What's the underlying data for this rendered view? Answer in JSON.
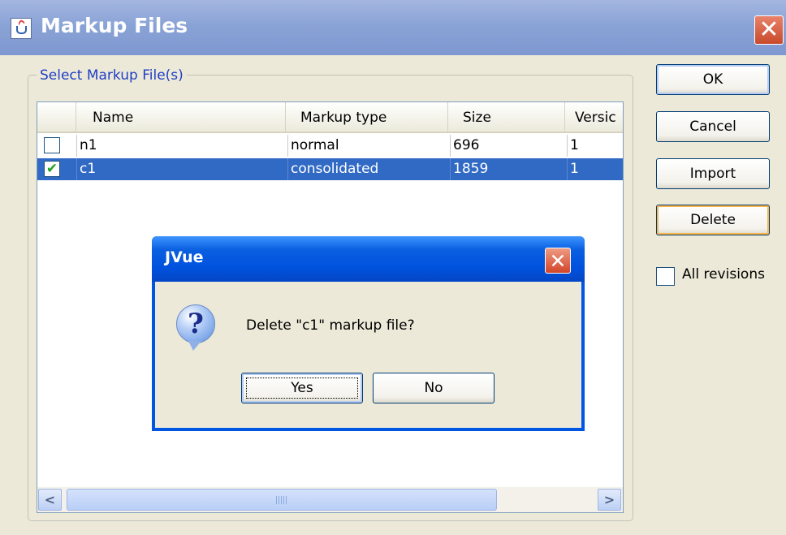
{
  "window": {
    "title": "Markup Files",
    "close_glyph": "✕",
    "app_icon": "java-cup-icon"
  },
  "group": {
    "legend": "Select Markup File(s)"
  },
  "table": {
    "columns": [
      "",
      "Name",
      "Markup type",
      "Size",
      "Versic"
    ],
    "rows": [
      {
        "checked": false,
        "name": "n1",
        "markup_type": "normal",
        "size": "696",
        "version": "1",
        "selected": false
      },
      {
        "checked": true,
        "name": "c1",
        "markup_type": "consolidated",
        "size": "1859",
        "version": "1",
        "selected": true
      }
    ],
    "check_glyph": "✔",
    "scroll_left": "<",
    "scroll_right": ">"
  },
  "buttons": {
    "ok": "OK",
    "cancel": "Cancel",
    "import": "Import",
    "delete": "Delete"
  },
  "all_revisions": {
    "label": "All revisions",
    "checked": false
  },
  "dialog": {
    "title": "JVue",
    "close_glyph": "✕",
    "icon": "question-icon",
    "icon_glyph": "?",
    "message": "Delete \"c1\" markup file?",
    "yes": "Yes",
    "no": "No"
  },
  "colors": {
    "selection": "#316ac5",
    "legend": "#1f3fc6",
    "dialog_titlebar": "#0052dd"
  }
}
